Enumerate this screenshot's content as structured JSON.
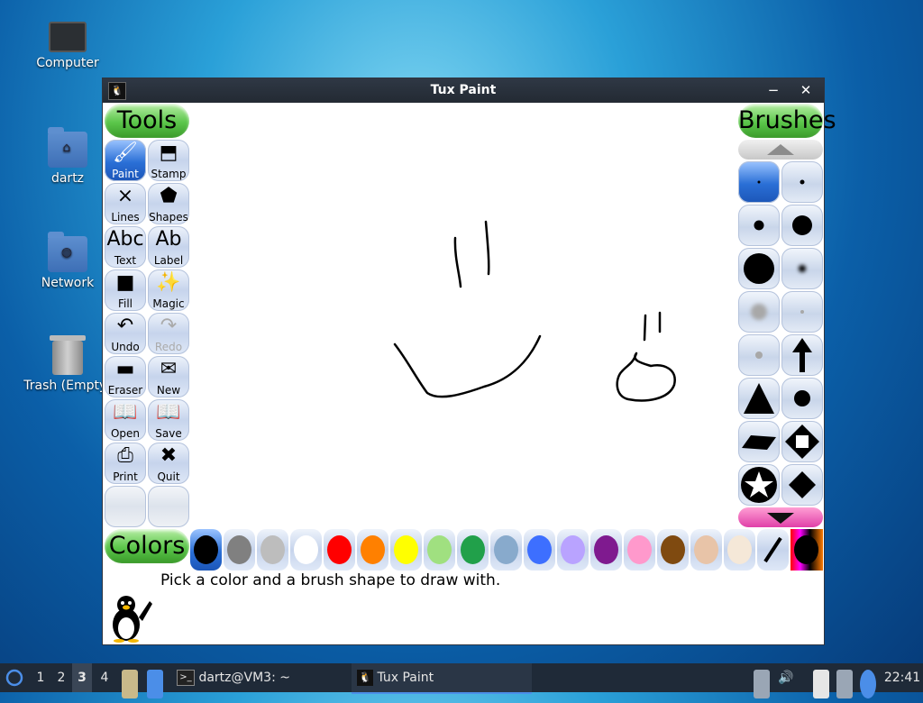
{
  "desktop": {
    "icons": [
      {
        "label": "Computer",
        "icon": "computer-icon"
      },
      {
        "label": "dartz",
        "icon": "home-folder-icon"
      },
      {
        "label": "Network",
        "icon": "network-folder-icon"
      },
      {
        "label": "Trash (Empty)",
        "icon": "trash-icon"
      }
    ]
  },
  "window": {
    "title": "Tux Paint",
    "min_label": "−",
    "close_label": "✕"
  },
  "tools": {
    "header": "Tools",
    "items": [
      {
        "label": "Paint",
        "glyph": "🖌",
        "state": "selected"
      },
      {
        "label": "Stamp",
        "glyph": "⬒"
      },
      {
        "label": "Lines",
        "glyph": "⨯"
      },
      {
        "label": "Shapes",
        "glyph": "⬟"
      },
      {
        "label": "Text",
        "glyph": "Abc"
      },
      {
        "label": "Label",
        "glyph": "Ab"
      },
      {
        "label": "Fill",
        "glyph": "■"
      },
      {
        "label": "Magic",
        "glyph": "✨"
      },
      {
        "label": "Undo",
        "glyph": "↶"
      },
      {
        "label": "Redo",
        "glyph": "↷",
        "state": "disabled"
      },
      {
        "label": "Eraser",
        "glyph": "▬"
      },
      {
        "label": "New",
        "glyph": "✉"
      },
      {
        "label": "Open",
        "glyph": "📖"
      },
      {
        "label": "Save",
        "glyph": "📖"
      },
      {
        "label": "Print",
        "glyph": "⎙"
      },
      {
        "label": "Quit",
        "glyph": "✖"
      }
    ]
  },
  "brushes": {
    "header": "Brushes"
  },
  "colors": {
    "header": "Colors",
    "swatches": [
      "#000000",
      "#808080",
      "#bdbdbd",
      "#ffffff",
      "#ff0000",
      "#ff8000",
      "#ffff00",
      "#a0e080",
      "#21a04a",
      "#88aacc",
      "#3d6fff",
      "#b9a3ff",
      "#7f1a8f",
      "#ff99cc",
      "#7f4a10",
      "#e8c4a8",
      "#f5e8d8"
    ],
    "selected_index": 0
  },
  "status_message": "Pick a color and a brush shape to draw with.",
  "taskbar": {
    "workspaces": [
      "1",
      "2",
      "3",
      "4"
    ],
    "active_workspace": "3",
    "tasks": [
      {
        "label": "dartz@VM3: ~",
        "icon": "terminal-icon",
        "active": false
      },
      {
        "label": "Tux Paint",
        "icon": "tux-icon",
        "active": true
      }
    ],
    "clock": "22:41"
  }
}
